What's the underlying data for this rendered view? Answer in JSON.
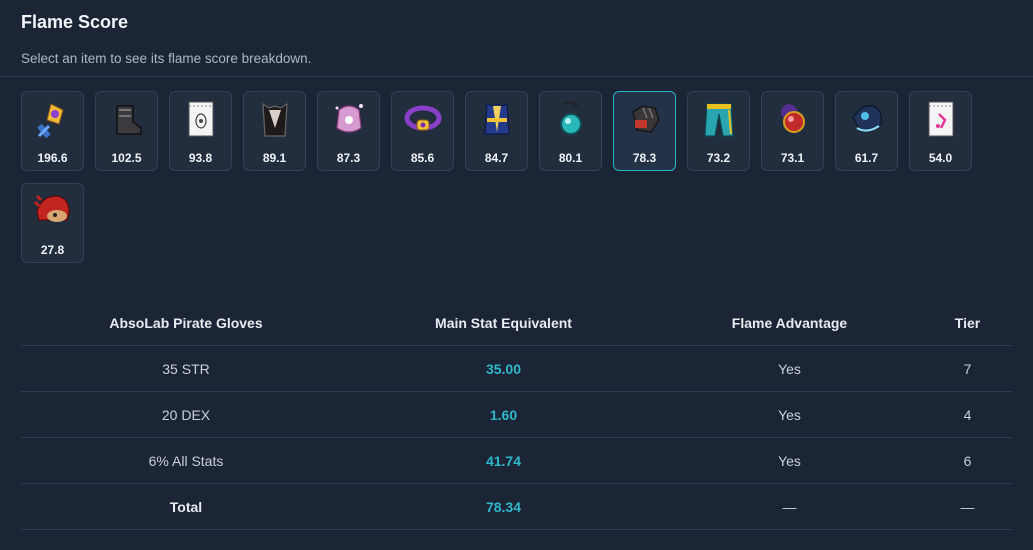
{
  "header": {
    "title": "Flame Score",
    "subtitle": "Select an item to see its flame score breakdown."
  },
  "items": [
    {
      "icon": "staff-weapon-icon",
      "score": "196.6",
      "selected": false
    },
    {
      "icon": "boots-icon",
      "score": "102.5",
      "selected": false
    },
    {
      "icon": "scroll-icon",
      "score": "93.8",
      "selected": false
    },
    {
      "icon": "cape-icon",
      "score": "89.1",
      "selected": false
    },
    {
      "icon": "pocket-item-icon",
      "score": "87.3",
      "selected": false
    },
    {
      "icon": "belt-icon",
      "score": "85.6",
      "selected": false
    },
    {
      "icon": "overall-armor-icon",
      "score": "84.7",
      "selected": false
    },
    {
      "icon": "pendant-icon",
      "score": "80.1",
      "selected": false
    },
    {
      "icon": "gloves-icon",
      "score": "78.3",
      "selected": true
    },
    {
      "icon": "pants-icon",
      "score": "73.2",
      "selected": false
    },
    {
      "icon": "ruby-pendant-icon",
      "score": "73.1",
      "selected": false
    },
    {
      "icon": "shoulder-icon",
      "score": "61.7",
      "selected": false
    },
    {
      "icon": "pink-scroll-icon",
      "score": "54.0",
      "selected": false
    },
    {
      "icon": "hat-icon",
      "score": "27.8",
      "selected": false
    }
  ],
  "breakdown": {
    "columns": [
      "AbsoLab Pirate Gloves",
      "Main Stat Equivalent",
      "Flame Advantage",
      "Tier"
    ],
    "rows": [
      {
        "name": "35 STR",
        "mse": "35.00",
        "advantage": "Yes",
        "tier": "7"
      },
      {
        "name": "20 DEX",
        "mse": "1.60",
        "advantage": "Yes",
        "tier": "4"
      },
      {
        "name": "6% All Stats",
        "mse": "41.74",
        "advantage": "Yes",
        "tier": "6"
      }
    ],
    "total": {
      "name": "Total",
      "mse": "78.34",
      "advantage": "—",
      "tier": "—"
    }
  },
  "colors": {
    "background": "#1b2536",
    "accent": "#2fb8cc",
    "card": "#222d3e"
  }
}
